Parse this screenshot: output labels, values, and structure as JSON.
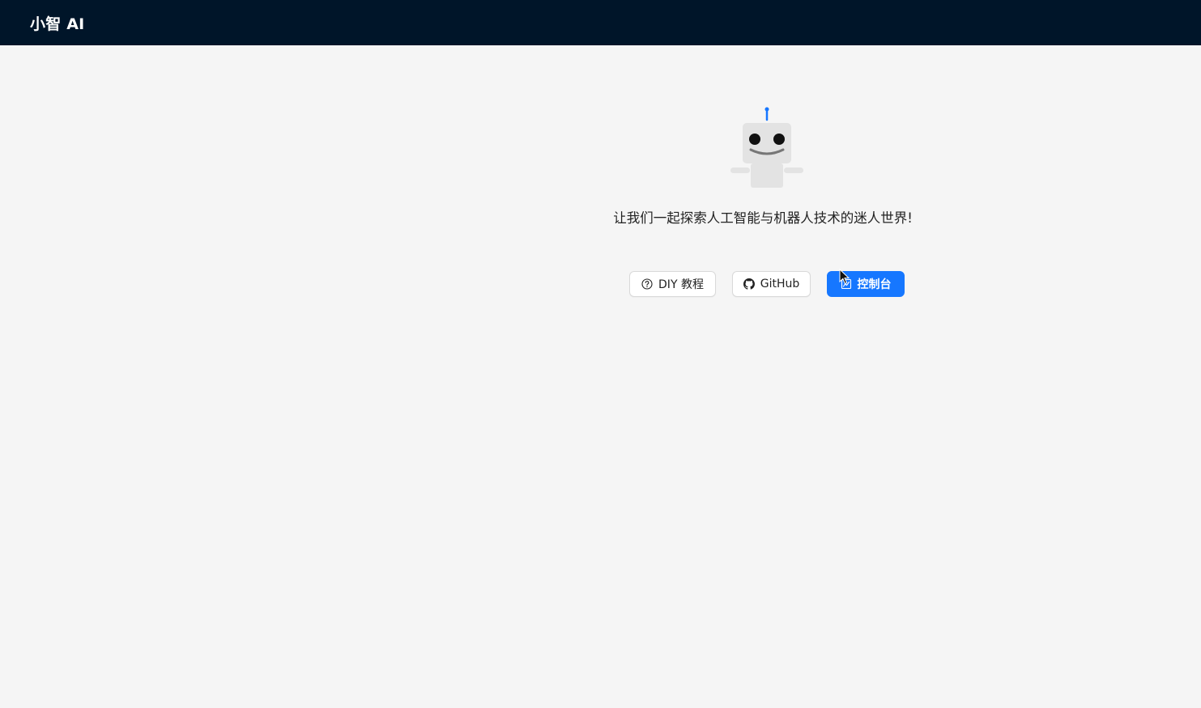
{
  "header": {
    "app_title": "小智 AI"
  },
  "hero": {
    "tagline": "让我们一起探索人工智能与机器人技术的迷人世界!"
  },
  "actions": {
    "diy_label": "DIY 教程",
    "github_label": "GitHub",
    "console_label": "控制台"
  },
  "icons": {
    "diy": "question-circle-icon",
    "github": "github-icon",
    "console": "dashboard-icon"
  },
  "colors": {
    "header_bg": "#001529",
    "page_bg": "#f5f5f5",
    "primary": "#1677ff",
    "robot_body": "#e3e3e3",
    "robot_antenna": "#1677ff"
  }
}
